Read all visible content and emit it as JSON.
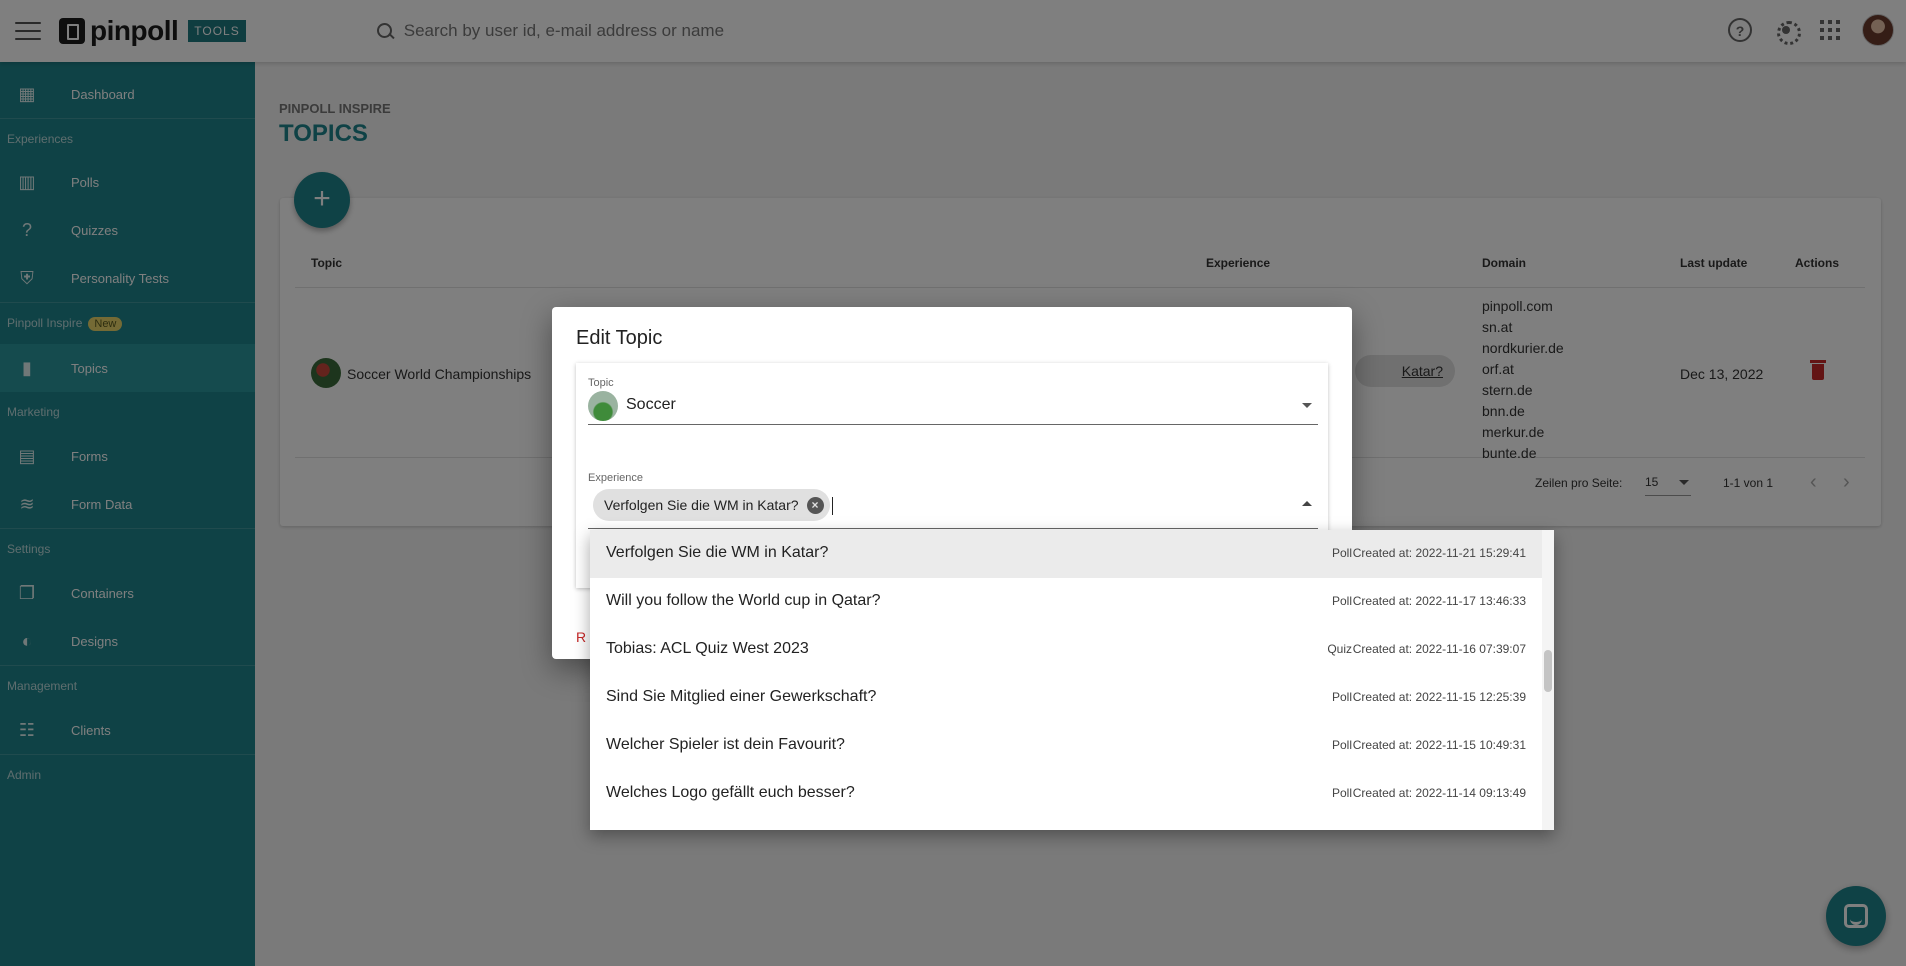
{
  "header": {
    "brand": "pinpoll",
    "tools_badge": "TOOLS",
    "search_placeholder": "Search by user id, e-mail address or name"
  },
  "sidebar": {
    "dashboard": "Dashboard",
    "sec_experiences": "Experiences",
    "polls": "Polls",
    "quizzes": "Quizzes",
    "personality_tests": "Personality Tests",
    "sec_inspire": "Pinpoll Inspire",
    "new_badge": "New",
    "topics": "Topics",
    "sec_marketing": "Marketing",
    "forms": "Forms",
    "form_data": "Form Data",
    "sec_settings": "Settings",
    "containers": "Containers",
    "designs": "Designs",
    "sec_management": "Management",
    "clients": "Clients",
    "sec_admin": "Admin"
  },
  "page": {
    "breadcrumb": "PINPOLL INSPIRE",
    "title": "TOPICS"
  },
  "table": {
    "col_topic": "Topic",
    "col_experience": "Experience",
    "col_domain": "Domain",
    "col_last_update": "Last update",
    "col_actions": "Actions",
    "row": {
      "topic": "Soccer World Championships",
      "experience_partial": "Katar?",
      "domains": [
        "pinpoll.com",
        "sn.at",
        "nordkurier.de",
        "orf.at",
        "stern.de",
        "bnn.de",
        "merkur.de",
        "bunte.de"
      ],
      "last_update": "Dec 13, 2022"
    },
    "rows_per_page_label": "Zeilen pro Seite:",
    "rows_per_page": "15",
    "range": "1-1 von 1"
  },
  "dialog": {
    "title": "Edit Topic",
    "topic_label": "Topic",
    "topic_value": "Soccer",
    "experience_label": "Experience",
    "experience_chip": "Verfolgen Sie die WM in Katar?",
    "action_partial": "R"
  },
  "dropdown": {
    "items": [
      {
        "title": "Verfolgen Sie die WM in Katar?",
        "type": "Poll",
        "created": "Created at: 2022-11-21 15:29:41"
      },
      {
        "title": "Will you follow the World cup in Qatar?",
        "type": "Poll",
        "created": "Created at: 2022-11-17 13:46:33"
      },
      {
        "title": "Tobias: ACL Quiz West 2023",
        "type": "Quiz",
        "created": "Created at: 2022-11-16 07:39:07"
      },
      {
        "title": "Sind Sie Mitglied einer Gewerkschaft?",
        "type": "Poll",
        "created": "Created at: 2022-11-15 12:25:39"
      },
      {
        "title": "Welcher Spieler ist dein Favourit?",
        "type": "Poll",
        "created": "Created at: 2022-11-15 10:49:31"
      },
      {
        "title": "Welches Logo gefällt euch besser?",
        "type": "Poll",
        "created": "Created at: 2022-11-14 09:13:49"
      }
    ]
  },
  "colors": {
    "brand_teal": "#1f858c",
    "danger": "#c62828"
  }
}
